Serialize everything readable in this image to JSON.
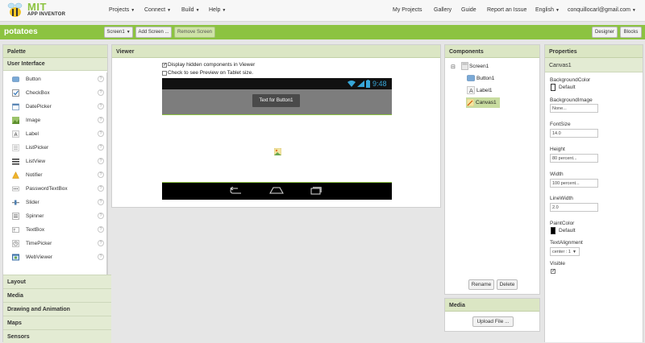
{
  "brand": {
    "title": "MIT",
    "subtitle": "APP INVENTOR"
  },
  "topnav": {
    "left": [
      "Projects",
      "Connect",
      "Build",
      "Help"
    ],
    "right": {
      "my_projects": "My Projects",
      "gallery": "Gallery",
      "guide": "Guide",
      "report": "Report an Issue",
      "language": "English",
      "user": "conquillocarl@gmail.com"
    }
  },
  "project": {
    "name": "potatoes",
    "screen_select": "Screen1",
    "add_screen": "Add Screen ...",
    "remove_screen": "Remove Screen",
    "designer": "Designer",
    "blocks": "Blocks"
  },
  "palette": {
    "title": "Palette",
    "section": "User Interface",
    "items": [
      {
        "label": "Button",
        "icon": "button-icon"
      },
      {
        "label": "CheckBox",
        "icon": "checkbox-icon"
      },
      {
        "label": "DatePicker",
        "icon": "datepicker-icon"
      },
      {
        "label": "Image",
        "icon": "image-icon"
      },
      {
        "label": "Label",
        "icon": "label-icon"
      },
      {
        "label": "ListPicker",
        "icon": "listpicker-icon"
      },
      {
        "label": "ListView",
        "icon": "listview-icon"
      },
      {
        "label": "Notifier",
        "icon": "notifier-icon"
      },
      {
        "label": "PasswordTextBox",
        "icon": "password-icon"
      },
      {
        "label": "Slider",
        "icon": "slider-icon"
      },
      {
        "label": "Spinner",
        "icon": "spinner-icon"
      },
      {
        "label": "TextBox",
        "icon": "textbox-icon"
      },
      {
        "label": "TimePicker",
        "icon": "timepicker-icon"
      },
      {
        "label": "WebViewer",
        "icon": "webviewer-icon"
      }
    ],
    "categories": [
      "Layout",
      "Media",
      "Drawing and Animation",
      "Maps",
      "Sensors"
    ],
    "help_glyph": "?"
  },
  "viewer": {
    "title": "Viewer",
    "display_hidden": "Display hidden components in Viewer",
    "tablet_preview": "Check to see Preview on Tablet size.",
    "time": "9:48",
    "button_text": "Text for Button1"
  },
  "components": {
    "title": "Components",
    "tree": {
      "root": "Screen1",
      "children": [
        "Button1",
        "Label1",
        "Canvas1"
      ],
      "selected": "Canvas1"
    },
    "rename": "Rename",
    "delete": "Delete"
  },
  "media": {
    "title": "Media",
    "upload": "Upload File ..."
  },
  "properties": {
    "title": "Properties",
    "component": "Canvas1",
    "background_color": {
      "label": "BackgroundColor",
      "value": "Default"
    },
    "background_image": {
      "label": "BackgroundImage",
      "value": "None..."
    },
    "font_size": {
      "label": "FontSize",
      "value": "14.0"
    },
    "height": {
      "label": "Height",
      "value": "80 percent..."
    },
    "width": {
      "label": "Width",
      "value": "100 percent..."
    },
    "line_width": {
      "label": "LineWidth",
      "value": "2.0"
    },
    "paint_color": {
      "label": "PaintColor",
      "value": "Default"
    },
    "text_alignment": {
      "label": "TextAlignment",
      "value": "center : 1"
    },
    "visible": {
      "label": "Visible"
    }
  },
  "colors": {
    "accent": "#8cc341",
    "panel_header": "#dbe6c4",
    "selected": "#c8dca0"
  }
}
